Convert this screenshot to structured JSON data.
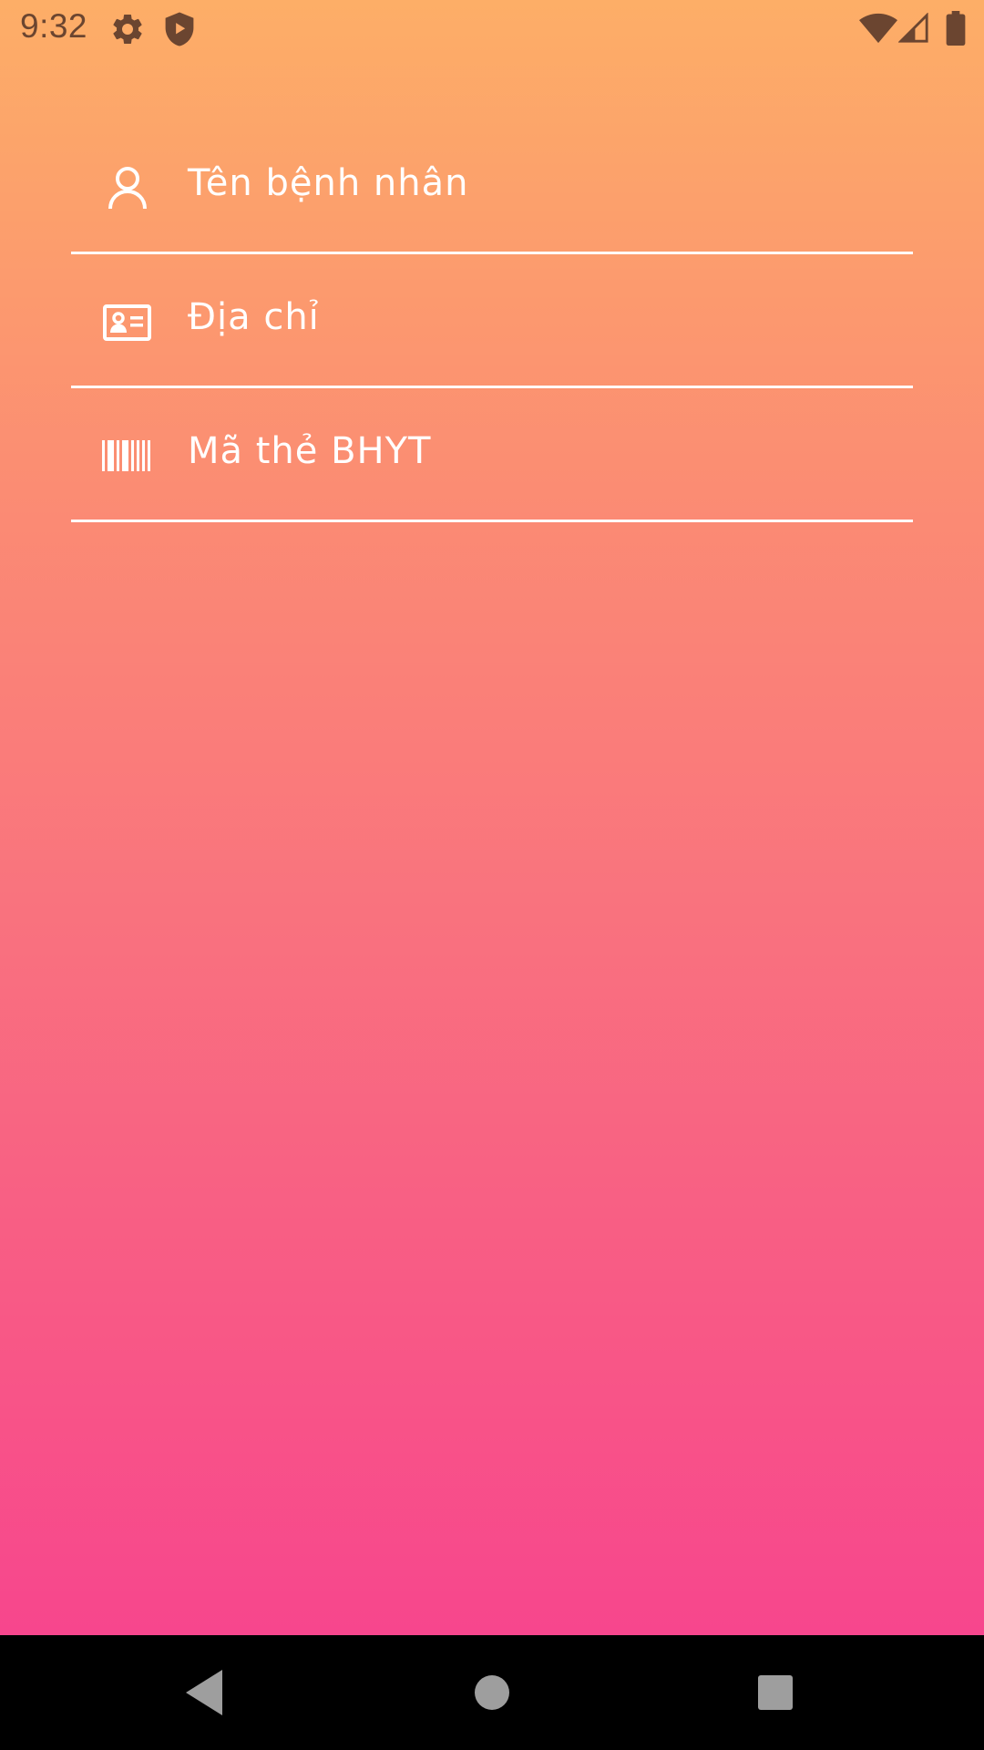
{
  "status_bar": {
    "time": "9:32",
    "icons": [
      "gear-icon",
      "shield-play-icon",
      "wifi-icon",
      "signal-icon",
      "battery-icon"
    ],
    "icon_color": "#6b4530"
  },
  "form": {
    "fields": [
      {
        "icon": "person-icon",
        "placeholder": "Tên bệnh nhân"
      },
      {
        "icon": "id-card-icon",
        "placeholder": "Địa chỉ"
      },
      {
        "icon": "barcode-icon",
        "placeholder": "Mã thẻ BHYT"
      }
    ]
  },
  "nav_bar": {
    "buttons": [
      "back-icon",
      "home-icon",
      "recents-icon"
    ],
    "button_color": "#9e9e9e"
  },
  "colors": {
    "gradient_top": "#fdae67",
    "gradient_bottom": "#f7468d",
    "text": "#ffffff"
  }
}
